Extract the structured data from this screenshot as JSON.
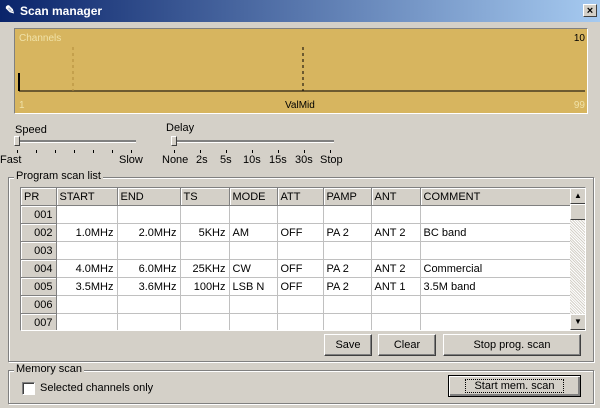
{
  "window": {
    "title": "Scan manager",
    "icon": "app-icon",
    "close_label": "×"
  },
  "channels": {
    "label": "Channels",
    "count": "10",
    "min": "1",
    "mid": "ValMid",
    "max": "99"
  },
  "speed": {
    "label": "Speed",
    "min_label": "Fast",
    "max_label": "Slow"
  },
  "delay": {
    "label": "Delay",
    "options": [
      "None",
      "2s",
      "5s",
      "10s",
      "15s",
      "30s",
      "Stop"
    ]
  },
  "program_scan": {
    "title": "Program scan list",
    "columns": [
      "PR",
      "START",
      "END",
      "TS",
      "MODE",
      "ATT",
      "PAMP",
      "ANT",
      "COMMENT"
    ],
    "rows": [
      [
        "001",
        "",
        "",
        "",
        "",
        "",
        "",
        "",
        ""
      ],
      [
        "002",
        "1.0MHz",
        "2.0MHz",
        "5KHz",
        "AM",
        "OFF",
        "PA 2",
        "ANT 2",
        "BC band"
      ],
      [
        "003",
        "",
        "",
        "",
        "",
        "",
        "",
        "",
        ""
      ],
      [
        "004",
        "4.0MHz",
        "6.0MHz",
        "25KHz",
        "CW",
        "OFF",
        "PA 2",
        "ANT 2",
        "Commercial"
      ],
      [
        "005",
        "3.5MHz",
        "3.6MHz",
        "100Hz",
        "LSB N",
        "OFF",
        "PA 2",
        "ANT 1",
        "3.5M band"
      ],
      [
        "006",
        "",
        "",
        "",
        "",
        "",
        "",
        "",
        ""
      ],
      [
        "007",
        "",
        "",
        "",
        "",
        "",
        "",
        "",
        ""
      ]
    ],
    "save_label": "Save",
    "clear_label": "Clear",
    "stop_label": "Stop prog. scan"
  },
  "memory_scan": {
    "title": "Memory scan",
    "checkbox_label": "Selected channels only",
    "checked": false,
    "start_label": "Start mem. scan"
  },
  "colors": {
    "display_bg": "#d7b55f",
    "title_start": "#0a246a",
    "title_end": "#a6caf0"
  }
}
